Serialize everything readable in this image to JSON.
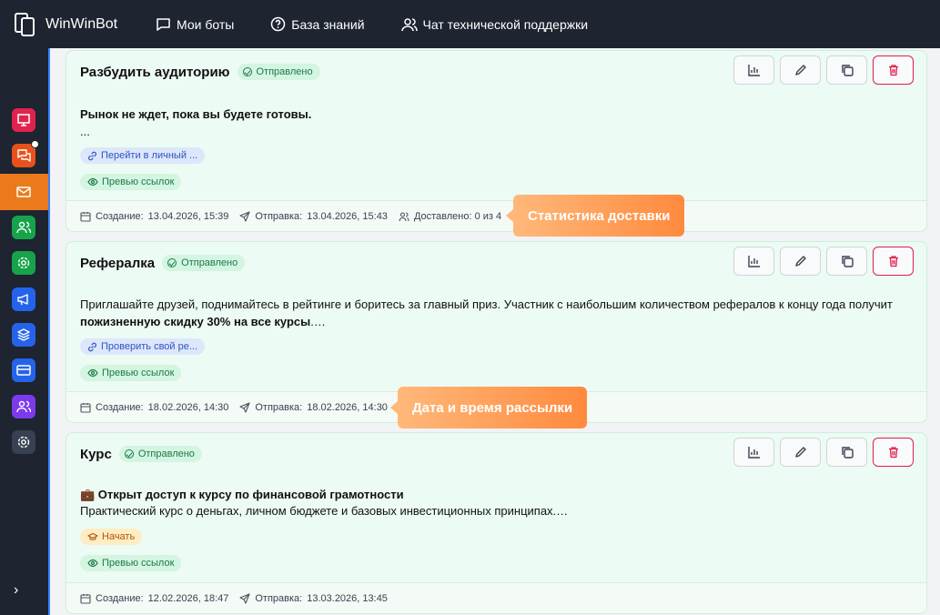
{
  "app": {
    "title": "WinWinBot"
  },
  "nav": {
    "items": [
      {
        "label": "Мои боты",
        "icon": "chat-icon"
      },
      {
        "label": "База знаний",
        "icon": "help-icon"
      },
      {
        "label": "Чат технической поддержки",
        "icon": "users-icon"
      }
    ]
  },
  "sidebar": {
    "items": [
      {
        "icon": "presentation-icon",
        "color": "#e0234e"
      },
      {
        "icon": "messages-icon",
        "color": "#e8511c",
        "notification": true
      },
      {
        "icon": "mail-icon",
        "color": "#ea7a1c",
        "active": true
      },
      {
        "icon": "users-icon",
        "color": "#16a34a"
      },
      {
        "icon": "gear-icon",
        "color": "#16a34a"
      },
      {
        "icon": "megaphone-icon",
        "color": "#2563eb"
      },
      {
        "icon": "layers-icon",
        "color": "#2563eb"
      },
      {
        "icon": "card-icon",
        "color": "#2563eb"
      },
      {
        "icon": "user-group-icon",
        "color": "#7c3aed"
      },
      {
        "icon": "settings-icon",
        "color": "#4b5563"
      }
    ],
    "expand": "›"
  },
  "labels": {
    "sent": "Отправлено",
    "preview": "Превью ссылок",
    "created": "Создание:",
    "sentAt": "Отправка:"
  },
  "cards": [
    {
      "title": "Разбудить аудиторию",
      "line1": "Рынок не ждет, пока вы будете готовы.",
      "line2": "...",
      "link": "Перейти в личный ...",
      "created": "13.04.2026, 15:39",
      "sent": "13.04.2026, 15:43",
      "delivered": "Доставлено: 0 из 4"
    },
    {
      "title": "Рефералка",
      "line1": "Приглашайте друзей, поднимайтесь в рейтинге и боритесь за главный приз. Участник с наибольшим количеством рефералов к концу года получит",
      "line2_bold": "пожизненную скидку 30% на все курсы",
      "line2_rest": ".…",
      "link": "Проверить свой ре...",
      "created": "18.02.2026, 14:30",
      "sent": "18.02.2026, 14:30"
    },
    {
      "title": "Курс",
      "line1": "💼 Открыт доступ к курсу по финансовой грамотности",
      "line2": "Практический курс о деньгах, личном бюджете и базовых инвестиционных принципах.…",
      "start": "Начать",
      "created": "12.02.2026, 18:47",
      "sent": "13.03.2026, 13:45"
    }
  ],
  "tooltips": {
    "delivery": "Статистика доставки",
    "datetime": "Дата и время рассылки"
  }
}
